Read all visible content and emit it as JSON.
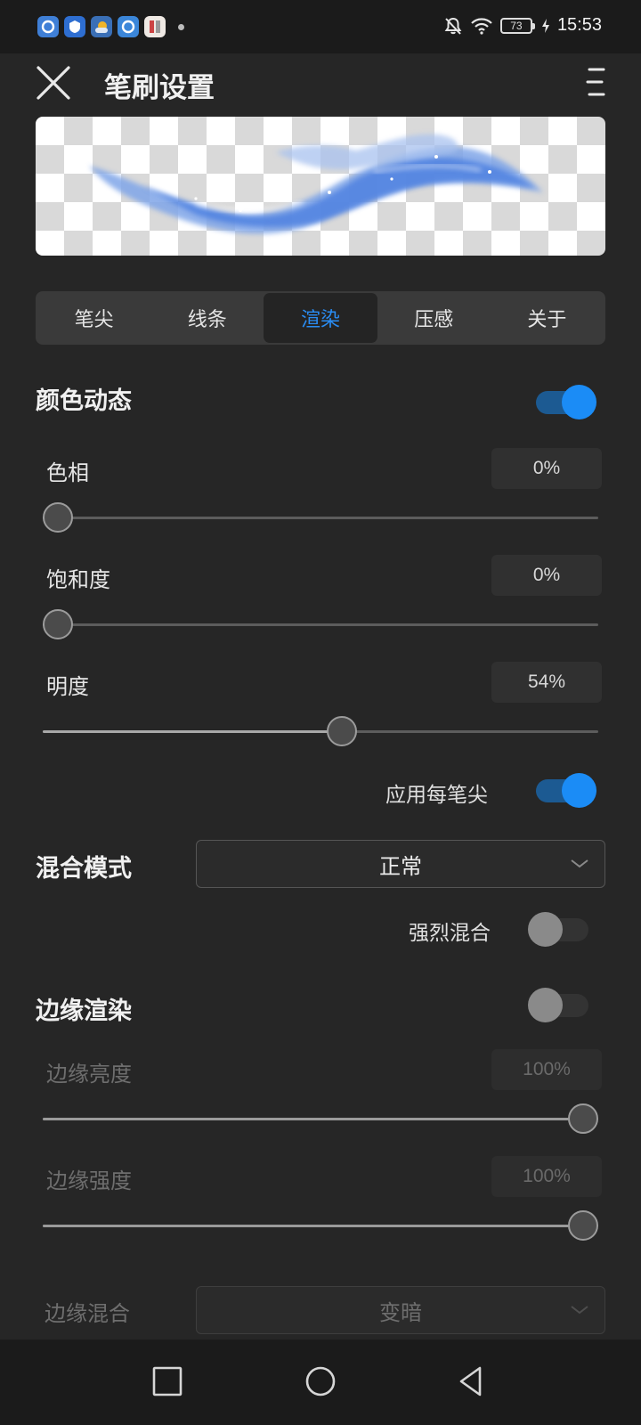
{
  "status_bar": {
    "battery": "73",
    "time": "15:53",
    "app_icons": [
      "app-icon-1",
      "app-icon-2",
      "app-icon-3",
      "app-icon-4",
      "app-icon-5"
    ]
  },
  "header": {
    "title": "笔刷设置"
  },
  "tabs": [
    {
      "label": "笔尖",
      "active": false
    },
    {
      "label": "线条",
      "active": false
    },
    {
      "label": "渲染",
      "active": true
    },
    {
      "label": "压感",
      "active": false
    },
    {
      "label": "关于",
      "active": false
    }
  ],
  "color_dynamics": {
    "title": "颜色动态",
    "enabled": true,
    "hue": {
      "label": "色相",
      "value": "0%",
      "level": 0
    },
    "saturation": {
      "label": "饱和度",
      "value": "0%",
      "level": 0
    },
    "brightness": {
      "label": "明度",
      "value": "54%",
      "level": 0.54
    },
    "apply_each_tip": {
      "label": "应用每笔尖",
      "enabled": true
    }
  },
  "blend_mode": {
    "title": "混合模式",
    "selected": "正常",
    "strong_blend": {
      "label": "强烈混合",
      "enabled": false
    }
  },
  "edge_render": {
    "title": "边缘渲染",
    "enabled": false,
    "edge_brightness": {
      "label": "边缘亮度",
      "value": "100%",
      "level": 1
    },
    "edge_strength": {
      "label": "边缘强度",
      "value": "100%",
      "level": 1
    },
    "edge_blend": {
      "label": "边缘混合",
      "selected": "变暗"
    }
  },
  "colors": {
    "accent": "#1b8cf6",
    "background": "#262626"
  }
}
